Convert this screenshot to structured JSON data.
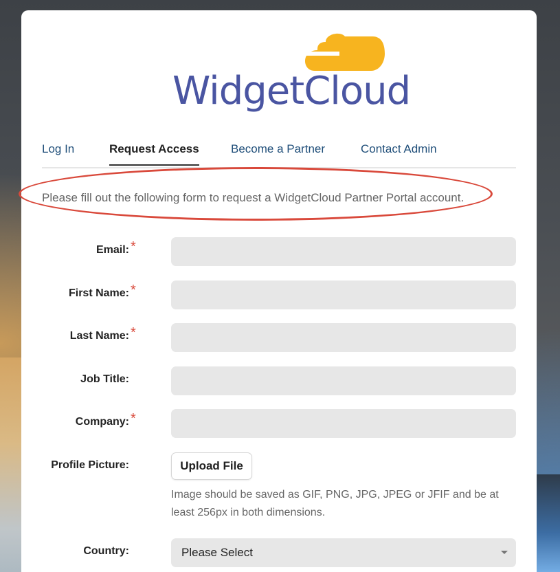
{
  "brand": {
    "name": "WidgetCloud",
    "text_color": "#4a55a2",
    "cloud_color": "#f7b41f"
  },
  "tabs": [
    {
      "label": "Log In",
      "active": false
    },
    {
      "label": "Request Access",
      "active": true
    },
    {
      "label": "Become a Partner",
      "active": false
    },
    {
      "label": "Contact Admin",
      "active": false
    }
  ],
  "intro_text": "Please fill out the following form to request a WidgetCloud Partner Portal account.",
  "required_mark": "*",
  "form": {
    "email_label": "Email:",
    "first_name_label": "First Name:",
    "last_name_label": "Last Name:",
    "job_title_label": "Job Title:",
    "company_label": "Company:",
    "profile_picture_label": "Profile Picture:",
    "upload_button_label": "Upload File",
    "upload_hint": "Image should be saved as GIF, PNG, JPG, JPEG or JFIF and be at least 256px in both dimensions.",
    "country_label": "Country:",
    "country_selected": "Please Select"
  },
  "colors": {
    "link": "#1f4e79",
    "required": "#d9493b",
    "annotation": "#d9493b",
    "input_bg": "#e7e7e7"
  }
}
